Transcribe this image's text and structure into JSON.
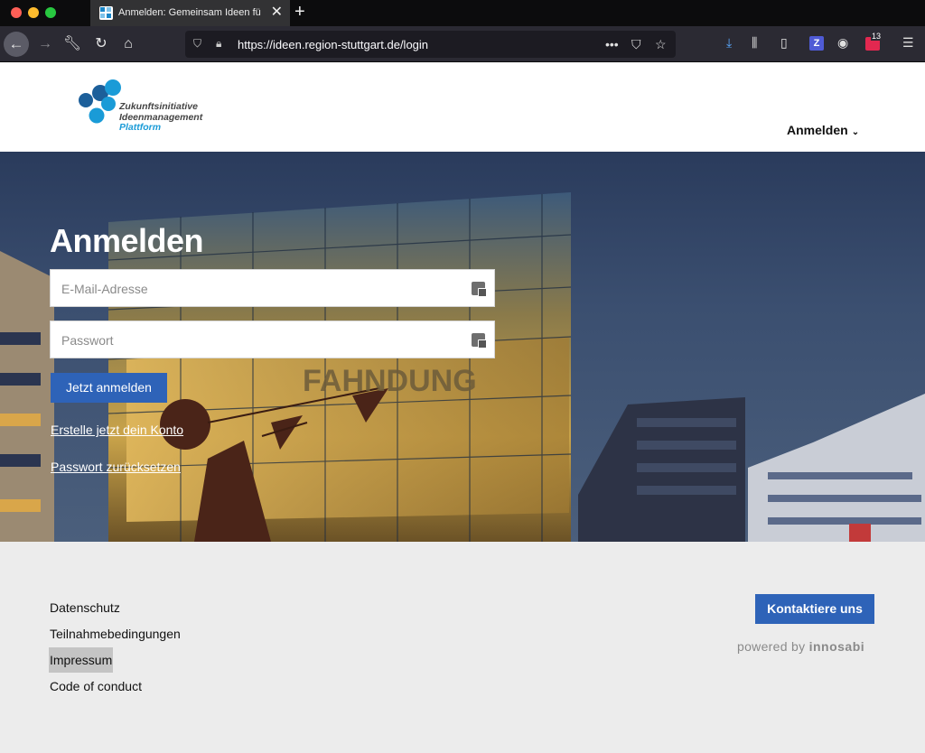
{
  "browser": {
    "tab_title": "Anmelden: Gemeinsam Ideen fü",
    "url": "https://ideen.region-stuttgart.de/login",
    "extension_z": "Z",
    "extension_count": "13"
  },
  "header": {
    "logo_line1": "Zukunftsinitiative",
    "logo_line2": "Ideenmanagement",
    "logo_line3": "Plattform",
    "login_menu": "Anmelden",
    "brand_color": "#1a9bd7"
  },
  "login": {
    "title": "Anmelden",
    "email_placeholder": "E-Mail-Adresse",
    "password_placeholder": "Passwort",
    "submit_label": "Jetzt anmelden",
    "create_account": "Erstelle jetzt dein Konto",
    "reset_password": "Passwort zurücksetzen",
    "button_color": "#2e63b8"
  },
  "hero_background": {
    "building_sign": "FAHNDUNG"
  },
  "footer": {
    "links": [
      "Datenschutz",
      "Teilnahmebedingungen",
      "Impressum",
      "Code of conduct"
    ],
    "contact_label": "Kontaktiere uns",
    "powered_by": "powered by",
    "vendor": "innosabi"
  }
}
